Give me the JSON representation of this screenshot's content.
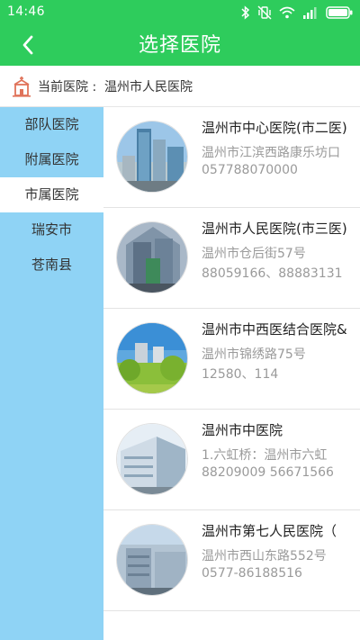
{
  "status_bar": {
    "time": "14:46",
    "icons": [
      "bluetooth-icon",
      "vibrate-icon",
      "wifi-icon",
      "signal-icon",
      "battery-icon"
    ],
    "battery_color": "#ffffff"
  },
  "header": {
    "title": "选择医院",
    "back_icon": "chevron-left-icon",
    "background": "#2ecc5c"
  },
  "current_hospital": {
    "label": "当前医院 :",
    "value": "温州市人民医院",
    "icon": "hospital-building-icon"
  },
  "sidebar": {
    "background": "#8fd3f5",
    "items": [
      {
        "label": "部队医院",
        "active": false
      },
      {
        "label": "附属医院",
        "active": false
      },
      {
        "label": "市属医院",
        "active": true
      },
      {
        "label": "瑞安市",
        "active": false
      },
      {
        "label": "苍南县",
        "active": false
      }
    ]
  },
  "hospitals": [
    {
      "name": "温州市中心医院(市二医)",
      "address": "温州市江滨西路康乐坊口",
      "phone": "057788070000"
    },
    {
      "name": "温州市人民医院(市三医)",
      "address": "温州市仓后街57号",
      "phone": "88059166、88883131"
    },
    {
      "name": "温州市中西医结合医院&",
      "address": "温州市锦绣路75号",
      "phone": "12580、114"
    },
    {
      "name": "温州市中医院",
      "address": "1.六虹桥：温州市六虹",
      "phone": "88209009 56671566"
    },
    {
      "name": "温州市第七人民医院（",
      "address": "温州市西山东路552号",
      "phone": "0577-86188516"
    }
  ]
}
